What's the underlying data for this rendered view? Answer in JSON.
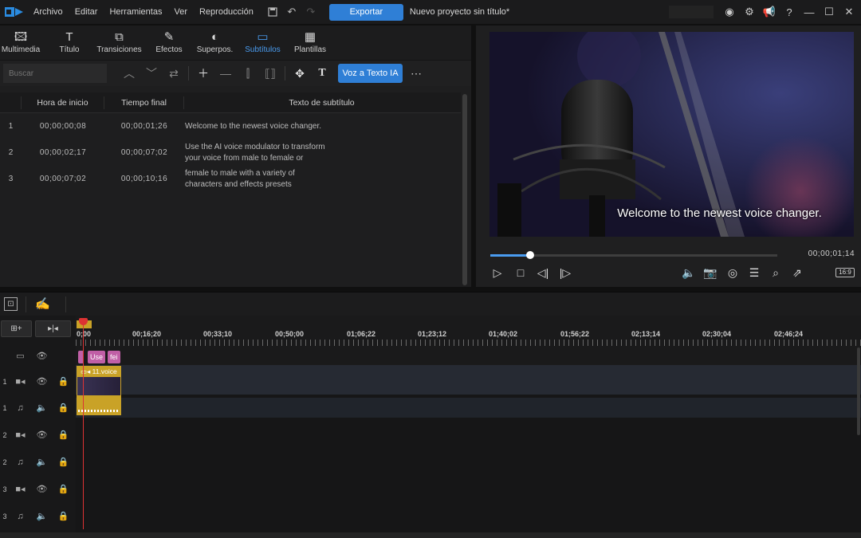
{
  "titlebar": {
    "menu": [
      "Archivo",
      "Editar",
      "Herramientas",
      "Ver",
      "Reproducción"
    ],
    "export_label": "Exportar",
    "project_title": "Nuevo proyecto sin título*",
    "help": "?"
  },
  "tabs": [
    {
      "label": "Multimedia",
      "icon": "media-icon"
    },
    {
      "label": "Título",
      "icon": "title-icon"
    },
    {
      "label": "Transiciones",
      "icon": "transitions-icon"
    },
    {
      "label": "Efectos",
      "icon": "effects-icon"
    },
    {
      "label": "Superpos.",
      "icon": "overlay-icon"
    },
    {
      "label": "Subtítulos",
      "icon": "subtitles-icon",
      "active": true
    },
    {
      "label": "Plantillas",
      "icon": "templates-icon"
    }
  ],
  "subtitle_toolbar": {
    "search_placeholder": "Buscar",
    "ai_voice_label": "Voz a Texto IA"
  },
  "subtitle_table": {
    "headers": [
      "Hora de inicio",
      "Tiempo final",
      "Texto de subtítulo"
    ],
    "rows": [
      {
        "index": "1",
        "start": "00;00;00;08",
        "end": "00;00;01;26",
        "text": "Welcome to the newest voice changer."
      },
      {
        "index": "2",
        "start": "00;00;02;17",
        "end": "00;00;07;02",
        "text": "Use the AI voice modulator to transform\nyour voice from male to female or"
      },
      {
        "index": "3",
        "start": "00;00;07;02",
        "end": "00;00;10;16",
        "text": "female to male with a variety of\ncharacters and effects presets"
      }
    ]
  },
  "preview": {
    "caption": "Welcome to the newest voice changer.",
    "timecode": "00;00;01;14",
    "progress_fraction": 0.14,
    "aspect_ratio": "16:9"
  },
  "timeline": {
    "ruler_labels": [
      "0;00",
      "00;16;20",
      "00;33;10",
      "00;50;00",
      "01;06;22",
      "01;23;12",
      "01;40;02",
      "01;56;22",
      "02;13;14",
      "02;30;04",
      "02;46;24"
    ],
    "tracks": [
      {
        "num": "",
        "type": "subtitle"
      },
      {
        "num": "1",
        "type": "video"
      },
      {
        "num": "1",
        "type": "audio"
      },
      {
        "num": "2",
        "type": "video"
      },
      {
        "num": "2",
        "type": "audio"
      },
      {
        "num": "3",
        "type": "video"
      },
      {
        "num": "3",
        "type": "audio"
      }
    ],
    "subtitle_clips": [
      "Use",
      "fei"
    ],
    "video_clip_label": "11.voice"
  },
  "colors": {
    "accent": "#2f7fd6",
    "clip_gold": "#c9a227",
    "subtitle_clip": "#c05fa6",
    "playhead": "#dd3333"
  }
}
